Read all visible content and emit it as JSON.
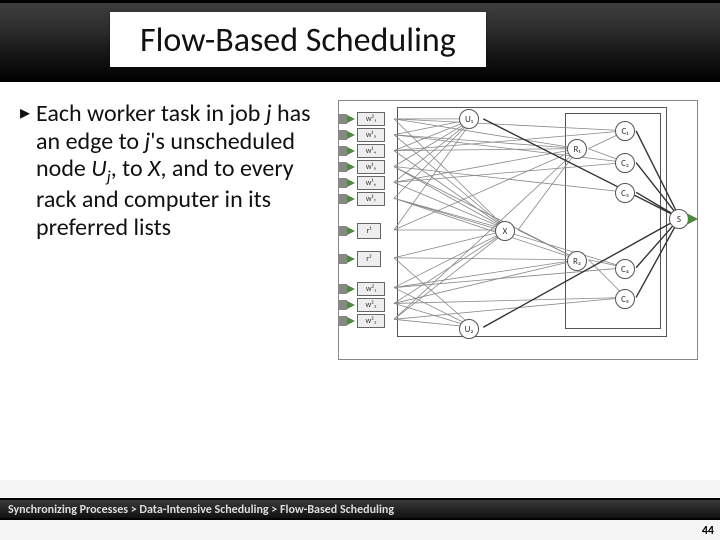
{
  "title": "Flow-Based Scheduling",
  "bullet_marker": "▸",
  "bullet_html": "Each worker task in job <span class='em'>j</span> has an edge to <span class='em'>j</span>'s unscheduled node <span class='em'>U<sub>j</sub></span>, to <span class='em'>X</span>, and to every rack and computer in its preferred lists",
  "diagram": {
    "w1": [
      "w²₁",
      "w¹₃",
      "w¹₄",
      "w¹₅",
      "w¹₆",
      "w¹₇"
    ],
    "r": [
      "r¹",
      "r²"
    ],
    "w2": [
      "w²₁",
      "w²₂",
      "w²₃"
    ],
    "U": [
      "U₁",
      "U₂"
    ],
    "X": "X",
    "R": [
      "R₁",
      "R₂"
    ],
    "C": [
      "C₁",
      "C₂",
      "C₃",
      "C₄"
    ],
    "S": "S"
  },
  "breadcrumb": "Synchronizing Processes > Data-Intensive Scheduling > Flow-Based Scheduling",
  "page_number": "44"
}
